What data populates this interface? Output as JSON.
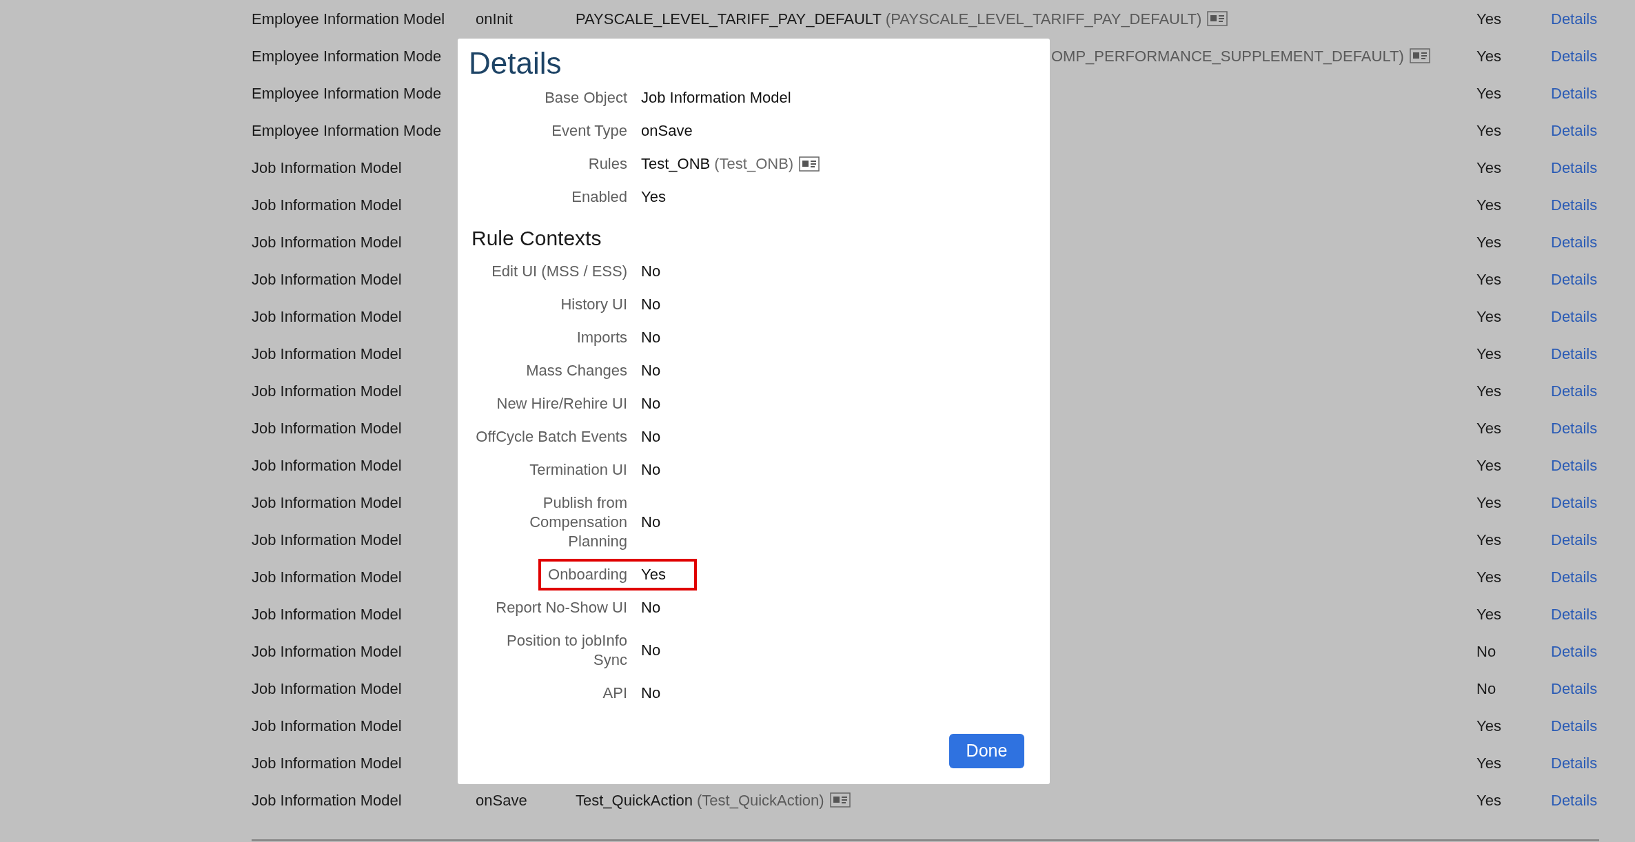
{
  "table": {
    "rows": [
      {
        "name": "Employee Information Model",
        "event": "onInit",
        "rule": "PAYSCALE_LEVEL_TARIFF_PAY_DEFAULT",
        "rule_id": "(PAYSCALE_LEVEL_TARIFF_PAY_DEFAULT)",
        "enabled": "Yes",
        "link": "Details"
      },
      {
        "name": "Employee Information Mode",
        "rule_id": "OMP_PERFORMANCE_SUPPLEMENT_DEFAULT)",
        "enabled": "Yes",
        "link": "Details"
      },
      {
        "name": "Employee Information Mode",
        "enabled": "Yes",
        "link": "Details"
      },
      {
        "name": "Employee Information Mode",
        "enabled": "Yes",
        "link": "Details"
      },
      {
        "name": "Job Information Model",
        "enabled": "Yes",
        "link": "Details"
      },
      {
        "name": "Job Information Model",
        "enabled": "Yes",
        "link": "Details"
      },
      {
        "name": "Job Information Model",
        "enabled": "Yes",
        "link": "Details"
      },
      {
        "name": "Job Information Model",
        "enabled": "Yes",
        "link": "Details"
      },
      {
        "name": "Job Information Model",
        "enabled": "Yes",
        "link": "Details"
      },
      {
        "name": "Job Information Model",
        "enabled": "Yes",
        "link": "Details"
      },
      {
        "name": "Job Information Model",
        "enabled": "Yes",
        "link": "Details"
      },
      {
        "name": "Job Information Model",
        "enabled": "Yes",
        "link": "Details"
      },
      {
        "name": "Job Information Model",
        "enabled": "Yes",
        "link": "Details"
      },
      {
        "name": "Job Information Model",
        "enabled": "Yes",
        "link": "Details"
      },
      {
        "name": "Job Information Model",
        "enabled": "Yes",
        "link": "Details"
      },
      {
        "name": "Job Information Model",
        "enabled": "Yes",
        "link": "Details"
      },
      {
        "name": "Job Information Model",
        "enabled": "Yes",
        "link": "Details"
      },
      {
        "name": "Job Information Model",
        "enabled": "No",
        "link": "Details"
      },
      {
        "name": "Job Information Model",
        "enabled": "No",
        "link": "Details"
      },
      {
        "name": "Job Information Model",
        "enabled": "Yes",
        "link": "Details"
      },
      {
        "name": "Job Information Model",
        "enabled": "Yes",
        "link": "Details"
      },
      {
        "name": "Job Information Model",
        "event": "onSave",
        "rule": "Test_QuickAction",
        "rule_id": "(Test_QuickAction)",
        "enabled": "Yes",
        "link": "Details"
      }
    ]
  },
  "dialog": {
    "title": "Details",
    "fields": [
      {
        "label": "Base Object",
        "value": "Job Information Model"
      },
      {
        "label": "Event Type",
        "value": "onSave"
      },
      {
        "label": "Rules",
        "value": "Test_ONB",
        "value_id": "(Test_ONB)"
      },
      {
        "label": "Enabled",
        "value": "Yes"
      }
    ],
    "contexts_heading": "Rule Contexts",
    "contexts": [
      {
        "label": "Edit UI (MSS / ESS)",
        "value": "No",
        "highlighted": false
      },
      {
        "label": "History UI",
        "value": "No",
        "highlighted": false
      },
      {
        "label": "Imports",
        "value": "No",
        "highlighted": false
      },
      {
        "label": "Mass Changes",
        "value": "No",
        "highlighted": false
      },
      {
        "label": "New Hire/Rehire UI",
        "value": "No",
        "highlighted": false
      },
      {
        "label": "OffCycle Batch Events",
        "value": "No",
        "highlighted": false
      },
      {
        "label": "Termination UI",
        "value": "No",
        "highlighted": false
      },
      {
        "label": "Publish from\nCompensation\nPlanning",
        "value": "No",
        "highlighted": false
      },
      {
        "label": "Onboarding",
        "value": "Yes",
        "highlighted": true
      },
      {
        "label": "Report No-Show UI",
        "value": "No",
        "highlighted": false
      },
      {
        "label": "Position to jobInfo\nSync",
        "value": "No",
        "highlighted": false
      },
      {
        "label": "API",
        "value": "No",
        "highlighted": false
      }
    ],
    "button": "Done"
  }
}
